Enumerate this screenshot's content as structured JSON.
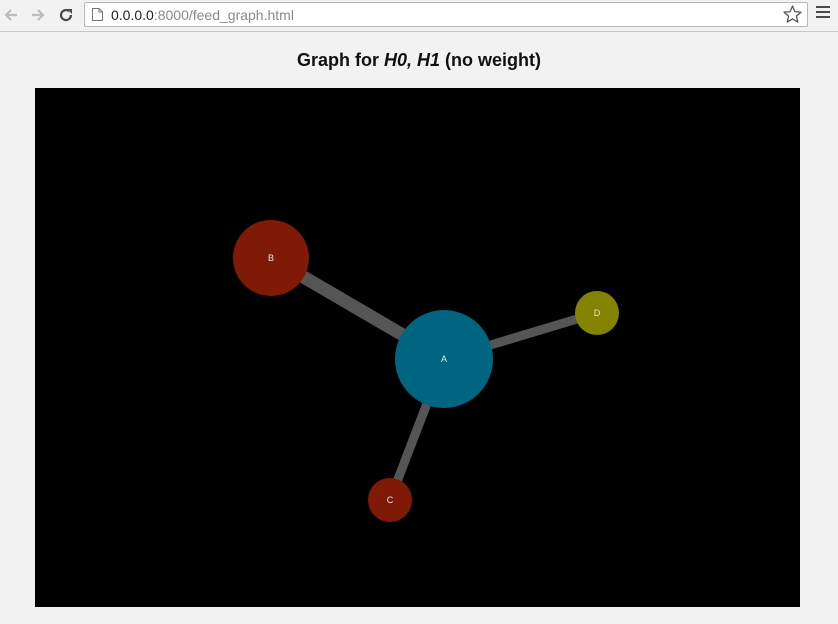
{
  "browser": {
    "url_host": "0.0.0.0",
    "url_rest": ":8000/feed_graph.html",
    "icons": {
      "back": "back-arrow-icon",
      "forward": "forward-arrow-icon",
      "reload": "reload-icon",
      "page": "page-icon",
      "bookmark": "star-icon",
      "menu": "hamburger-menu-icon"
    }
  },
  "page": {
    "title_prefix": "Graph for ",
    "title_italic": "H0, H1",
    "title_suffix": " (no weight)"
  },
  "graph": {
    "background": "#000000",
    "edge_color": "#555555",
    "nodes": [
      {
        "id": "A",
        "label": "A",
        "color": "#006580"
      },
      {
        "id": "B",
        "label": "B",
        "color": "#7f1a06"
      },
      {
        "id": "C",
        "label": "C",
        "color": "#7f1a06"
      },
      {
        "id": "D",
        "label": "D",
        "color": "#838300"
      }
    ],
    "edges": [
      {
        "source": "A",
        "target": "B"
      },
      {
        "source": "A",
        "target": "C"
      },
      {
        "source": "A",
        "target": "D"
      }
    ]
  }
}
